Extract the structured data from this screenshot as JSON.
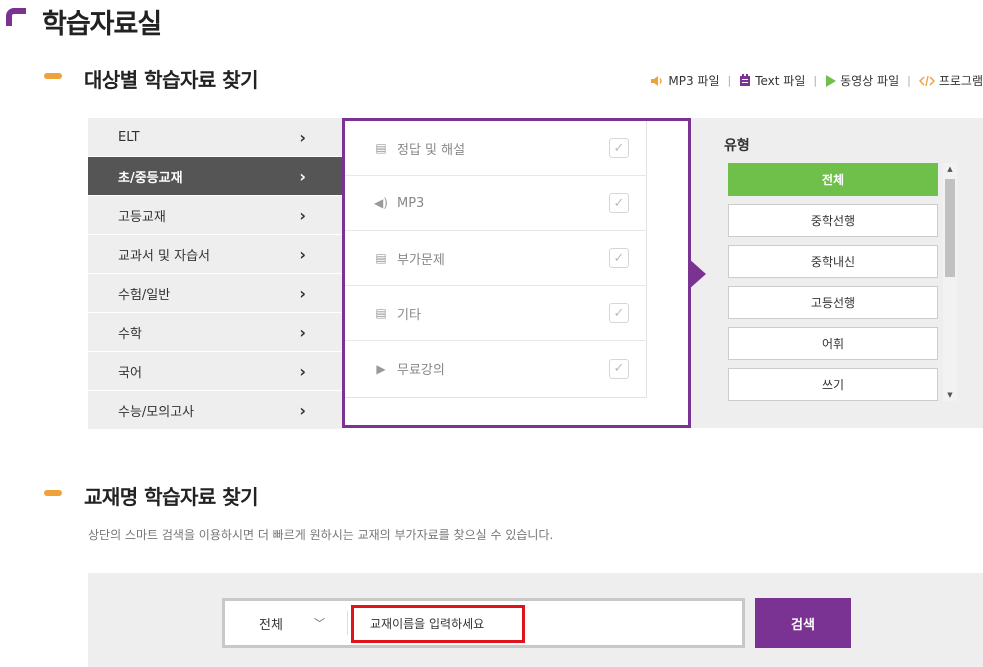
{
  "page": {
    "title": "학습자료실"
  },
  "section1": {
    "title": "대상별 학습자료 찾기",
    "legend": [
      {
        "icon": "speaker-icon",
        "label": "MP3 파일",
        "color": "#f0a23a"
      },
      {
        "icon": "document-icon",
        "label": "Text 파일",
        "color": "#7b3393"
      },
      {
        "icon": "play-icon",
        "label": "동영상 파일",
        "color": "#6ec04a"
      },
      {
        "icon": "code-icon",
        "label": "프로그램",
        "color": "#f0a23a"
      }
    ],
    "categories": [
      {
        "label": "ELT",
        "active": false
      },
      {
        "label": "초/중등교재",
        "active": true
      },
      {
        "label": "고등교재",
        "active": false
      },
      {
        "label": "교과서 및 자습서",
        "active": false
      },
      {
        "label": "수험/일반",
        "active": false
      },
      {
        "label": "수학",
        "active": false
      },
      {
        "label": "국어",
        "active": false
      },
      {
        "label": "수능/모의고사",
        "active": false
      }
    ],
    "types": [
      {
        "icon": "document-icon",
        "label": "정답 및 해설"
      },
      {
        "icon": "speaker-icon",
        "label": "MP3"
      },
      {
        "icon": "document-icon",
        "label": "부가문제"
      },
      {
        "icon": "document-icon",
        "label": "기타"
      },
      {
        "icon": "play-icon",
        "label": "무료강의"
      }
    ],
    "genre": {
      "title": "유형",
      "items": [
        {
          "label": "전체",
          "active": true
        },
        {
          "label": "중학선행",
          "active": false
        },
        {
          "label": "중학내신",
          "active": false
        },
        {
          "label": "고등선행",
          "active": false
        },
        {
          "label": "어휘",
          "active": false
        },
        {
          "label": "쓰기",
          "active": false
        }
      ]
    },
    "accent_purple": "#7b3393",
    "accent_green": "#6ec04a"
  },
  "section2": {
    "title": "교재명 학습자료 찾기",
    "description": "상단의 스마트 검색을 이용하시면 더 빠르게 원하시는 교재의 부가자료를 찾으실 수 있습니다.",
    "select_value": "전체",
    "input_placeholder": "교재이름을 입력하세요",
    "input_value": "",
    "search_label": "검색"
  }
}
